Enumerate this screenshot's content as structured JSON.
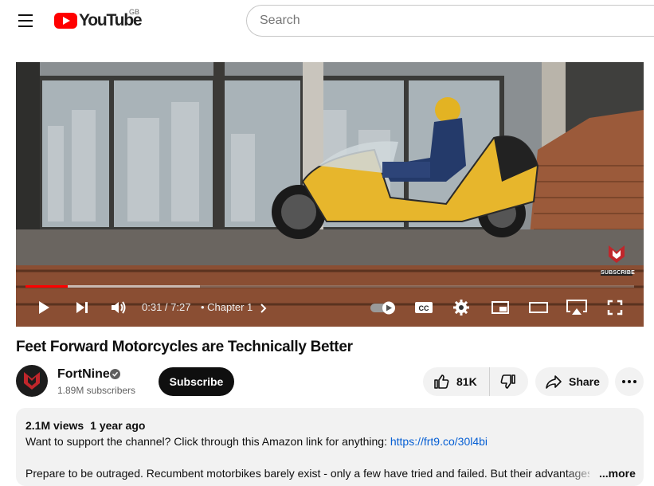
{
  "header": {
    "logo_text": "YouTube",
    "region": "GB",
    "search_placeholder": "Search"
  },
  "player": {
    "time_current": "0:31",
    "time_total": "7:27",
    "time_display": "0:31 / 7:27",
    "chapter_label": "Chapter 1",
    "progress_played": 0.069,
    "progress_loaded": 0.287,
    "watermark_text": "SUBSCRIBE"
  },
  "video": {
    "title": "Feet Forward Motorcycles are Technically Better"
  },
  "channel": {
    "name": "FortNine",
    "subscribers": "1.89M subscribers",
    "subscribe_label": "Subscribe"
  },
  "actions": {
    "like_count": "81K",
    "share_label": "Share"
  },
  "description": {
    "views": "2.1M views",
    "date": "1 year ago",
    "line1_text": "Want to support the channel? Click through this Amazon link for anything: ",
    "line1_link": "https://frt9.co/30l4bi",
    "line2_text": "Prepare to be outraged. Recumbent motorbikes barely exist - only a few have tried and failed. But their advantages a",
    "more_label": "...more"
  },
  "colors": {
    "brand_red": "#ff0000",
    "link_blue": "#065fd4",
    "pill_bg": "#f2f2f2"
  }
}
